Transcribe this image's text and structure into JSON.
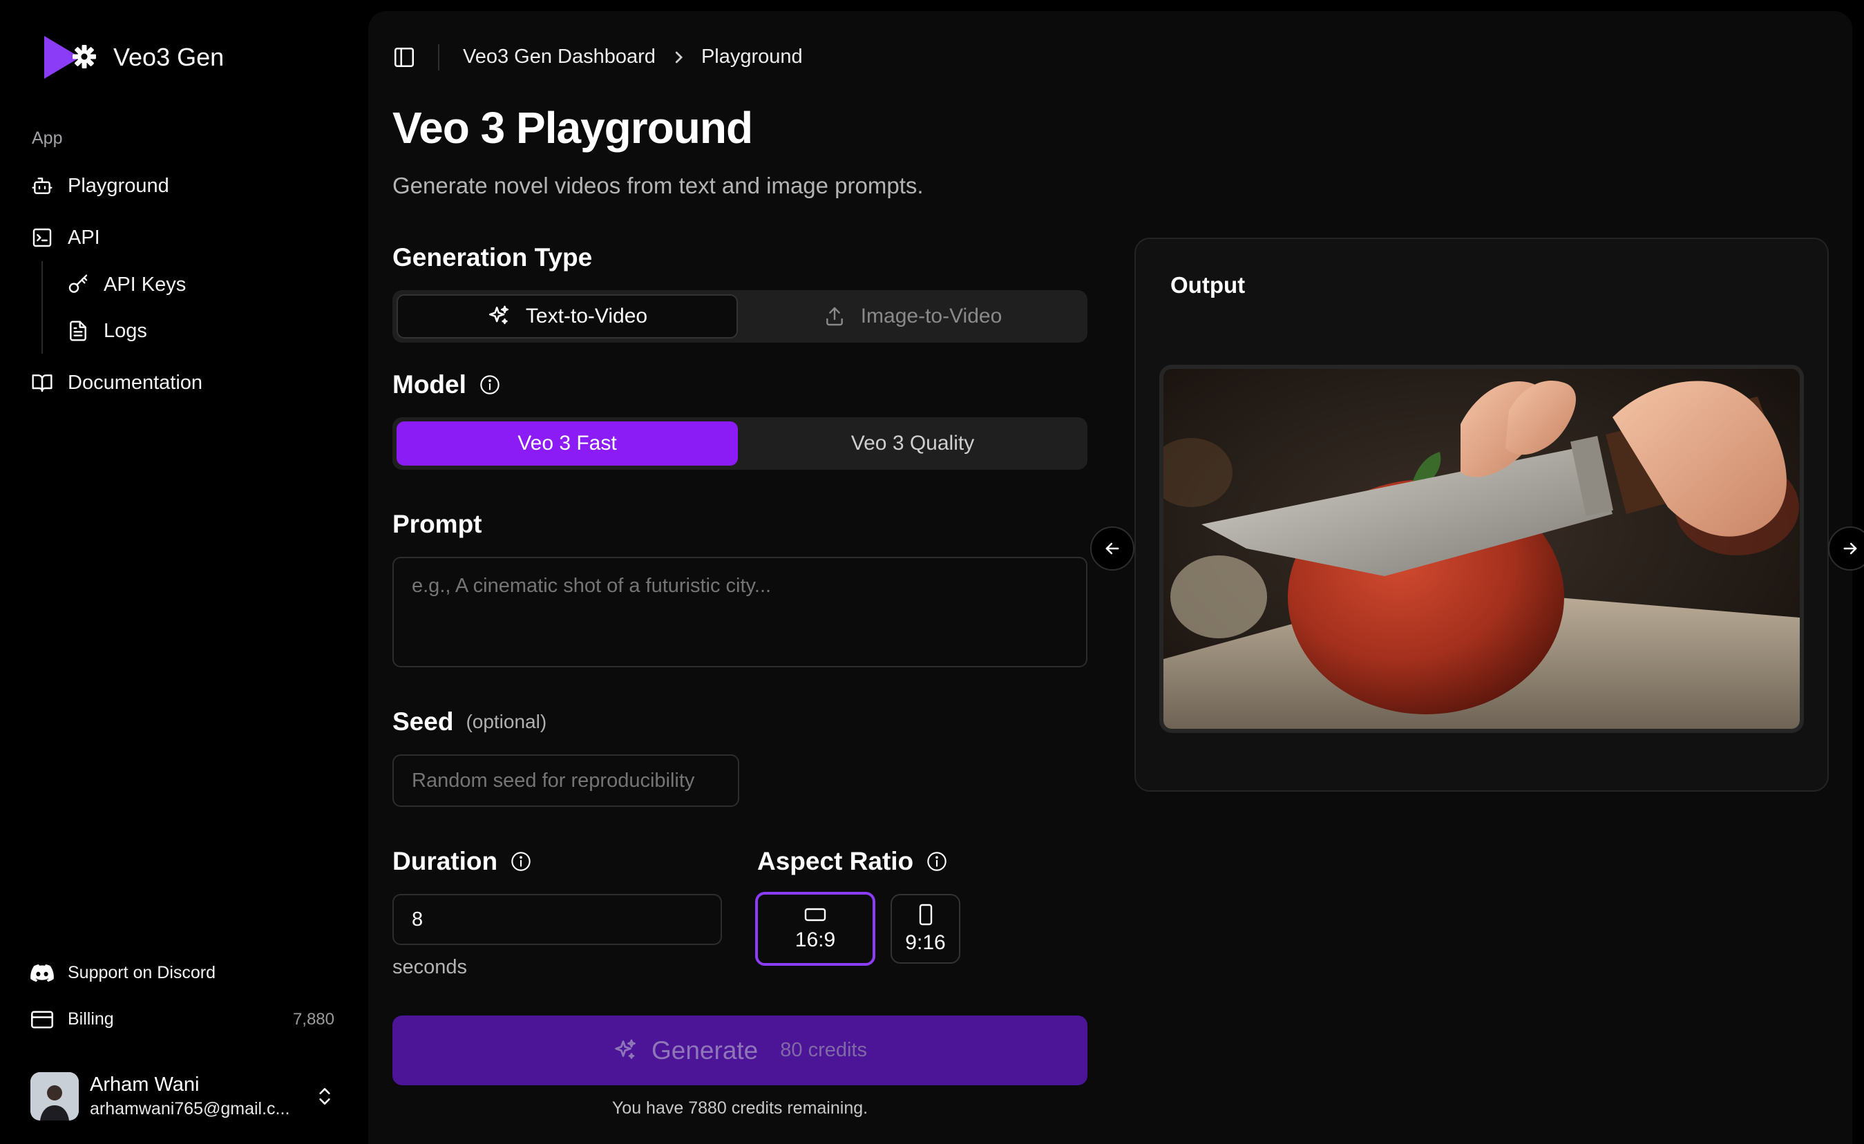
{
  "brand": {
    "name": "Veo3 Gen",
    "accent": "#8b3cf6"
  },
  "sidebar": {
    "section_label": "App",
    "items": [
      {
        "label": "Playground",
        "icon": "robot-icon"
      },
      {
        "label": "API",
        "icon": "terminal-icon"
      },
      {
        "label": "API Keys",
        "icon": "key-icon"
      },
      {
        "label": "Logs",
        "icon": "document-icon"
      },
      {
        "label": "Documentation",
        "icon": "book-icon"
      }
    ],
    "support_label": "Support on Discord",
    "billing_label": "Billing",
    "billing_credits": "7,880"
  },
  "user": {
    "name": "Arham Wani",
    "email": "arhamwani765@gmail.c..."
  },
  "breadcrumb": {
    "parent": "Veo3 Gen Dashboard",
    "current": "Playground"
  },
  "page": {
    "title": "Veo 3 Playground",
    "subtitle": "Generate novel videos from text and image prompts."
  },
  "generation_type": {
    "heading": "Generation Type",
    "options": [
      "Text-to-Video",
      "Image-to-Video"
    ],
    "selected": "Text-to-Video"
  },
  "model": {
    "heading": "Model",
    "options": [
      "Veo 3 Fast",
      "Veo 3 Quality"
    ],
    "selected": "Veo 3 Fast"
  },
  "prompt": {
    "heading": "Prompt",
    "value": "",
    "placeholder": "e.g., A cinematic shot of a futuristic city..."
  },
  "seed": {
    "heading": "Seed",
    "optional_label": "(optional)",
    "value": "",
    "placeholder": "Random seed for reproducibility"
  },
  "duration": {
    "heading": "Duration",
    "value": "8",
    "unit": "seconds"
  },
  "aspect_ratio": {
    "heading": "Aspect Ratio",
    "options": [
      "16:9",
      "9:16"
    ],
    "selected": "16:9"
  },
  "generate": {
    "label": "Generate",
    "cost": "80 credits",
    "remaining_text": "You have 7880 credits remaining."
  },
  "output": {
    "title": "Output"
  },
  "colors": {
    "accent": "#8b3cf6",
    "generate_bg": "#4c1598",
    "panel_bg": "#0b0b0b"
  }
}
